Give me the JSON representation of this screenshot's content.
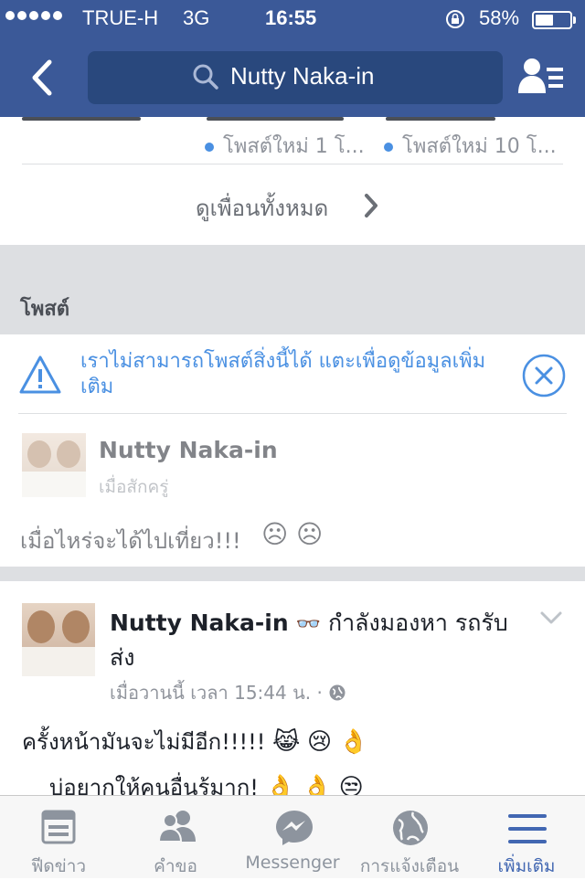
{
  "status_bar": {
    "carrier": "TRUE-H",
    "network": "3G",
    "time": "16:55",
    "battery_percent": "58%",
    "battery_level": 0.58
  },
  "header": {
    "search_query": "Nutty Naka-in",
    "back_icon": "back-chevron-icon",
    "friends_icon": "friend-requests-icon",
    "color": "#3b5998"
  },
  "friends": {
    "items": [
      {
        "status": "โพสต์ใหม่ 1 โ..."
      },
      {
        "status": "โพสต์ใหม่ 10 โ..."
      }
    ],
    "see_all": "ดูเพื่อนทั้งหมด"
  },
  "posts_section": {
    "title": "โพสต์",
    "error_message": "เราไม่สามารถโพสต์สิ่งนี้ได้ แตะเพื่อดูข้อมูลเพิ่มเติม"
  },
  "pending_post": {
    "author": "Nutty Naka-in",
    "time": "เมื่อสักครู่",
    "text": "เมื่อไหร่จะได้ไปเที่ยว!!!"
  },
  "post": {
    "author": "Nutty Naka-in",
    "activity": "กำลังมองหา รถรับส่ง",
    "time": "เมื่อวานนี้ เวลา 15:44 น.",
    "separator": "·",
    "line1": "ครั้งหน้ามันจะไม่มีอีก!!!!!",
    "line2": "บ่อยากให้คนอื่นรุ้มาก!"
  },
  "tabs": [
    {
      "label": "ฟีดข่าว",
      "icon": "news-feed-icon"
    },
    {
      "label": "คำขอ",
      "icon": "requests-icon"
    },
    {
      "label": "Messenger",
      "icon": "messenger-icon"
    },
    {
      "label": "การแจ้งเตือน",
      "icon": "globe-icon"
    },
    {
      "label": "เพิ่มเติม",
      "icon": "menu-icon"
    }
  ],
  "colors": {
    "brand": "#3b5998",
    "link": "#4a90e2",
    "active_tab": "#4267b2"
  }
}
